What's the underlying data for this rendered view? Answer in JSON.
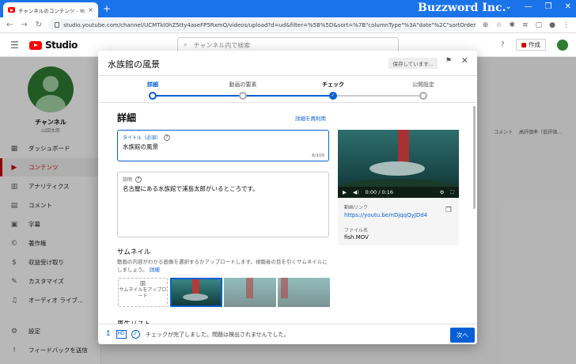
{
  "browser": {
    "tab_title": "チャンネルのコンテンツ - YouTube Stu",
    "tab_close": "×",
    "new_tab": "+",
    "brand": "Buzzword Inc.",
    "window_buttons": [
      "⌄",
      "—",
      "❐",
      "✕"
    ],
    "url": "studio.youtube.com/channel/UCMTkI0hZ5tty4aseFP5RxmQ/videos/upload?d=ud&filter=%5B%5D&sort=%7B\"columnType\"%3A\"date\"%2C\"sortOrder\"%3A\"DESCENDING\"%...",
    "nav": [
      "←",
      "→",
      "↻"
    ],
    "extensions": [
      "⊕",
      "☆",
      "✱",
      "≡",
      "▢",
      "●",
      "⋮"
    ]
  },
  "studio_header": {
    "logo_text": "Studio",
    "search_placeholder": "チャンネル内で検索",
    "help": "?",
    "create_label": "作成"
  },
  "sidebar": {
    "channel_name": "チャンネル",
    "channel_sub": "山田太郎",
    "items": [
      {
        "icon": "▦",
        "label": "ダッシュボード"
      },
      {
        "icon": "▶",
        "label": "コンテンツ"
      },
      {
        "icon": "▥",
        "label": "アナリティクス"
      },
      {
        "icon": "▤",
        "label": "コメント"
      },
      {
        "icon": "▣",
        "label": "字幕"
      },
      {
        "icon": "©",
        "label": "著作権"
      },
      {
        "icon": "$",
        "label": "収益受け取り"
      },
      {
        "icon": "✎",
        "label": "カスタマイズ"
      },
      {
        "icon": "♫",
        "label": "オーディオ ライブ..."
      },
      {
        "icon": "⚙",
        "label": "設定"
      },
      {
        "icon": "!",
        "label": "フィードバックを送信"
      }
    ]
  },
  "background_columns": [
    "コメント",
    "高評価率（低評価..."
  ],
  "dialog": {
    "title": "水族館の風景",
    "saving": "保存しています...",
    "flag_icon": "⚑",
    "close_icon": "✕",
    "steps": [
      {
        "label": "詳細",
        "state": "current"
      },
      {
        "label": "動画の要素",
        "state": "todo"
      },
      {
        "label": "チェック",
        "state": "done"
      },
      {
        "label": "公開設定",
        "state": "todo"
      }
    ],
    "step_done_mark": "✓",
    "section_title": "詳細",
    "reuse_link": "詳細を再利用",
    "title_field": {
      "label": "タイトル（必須）",
      "value": "水族館の風景",
      "counter": "6/100"
    },
    "desc_field": {
      "label": "説明",
      "value": "名古屋にある水族館で浦島太郎がいるところです。"
    },
    "help_mark": "?",
    "thumbnail": {
      "heading": "サムネイル",
      "description": "動画の内容がわかる画像を選択するかアップロードします。視聴者の目を引くサムネイルにしましょう。",
      "details_link": "詳細",
      "upload_icon": "⊞",
      "upload_label": "サムネイルをアップロード"
    },
    "playlist_heading": "再生リスト",
    "preview": {
      "time": "0:00 / 0:16",
      "play_icon": "▶",
      "volume_icon": "◀)",
      "settings_icon": "⚙",
      "fullscreen_icon": "⛶",
      "link_label": "動画リンク",
      "link": "https://youtu.be/nDjqqQyJDd4",
      "copy_icon": "❐",
      "filename_label": "ファイル名",
      "filename": "fish.MOV"
    },
    "footer": {
      "upload_icon": "↥",
      "hd_icon": "HD",
      "check_icon": "✓",
      "message": "チェックが完了しました。問題は検出されませんでした。",
      "next_label": "次へ"
    }
  }
}
